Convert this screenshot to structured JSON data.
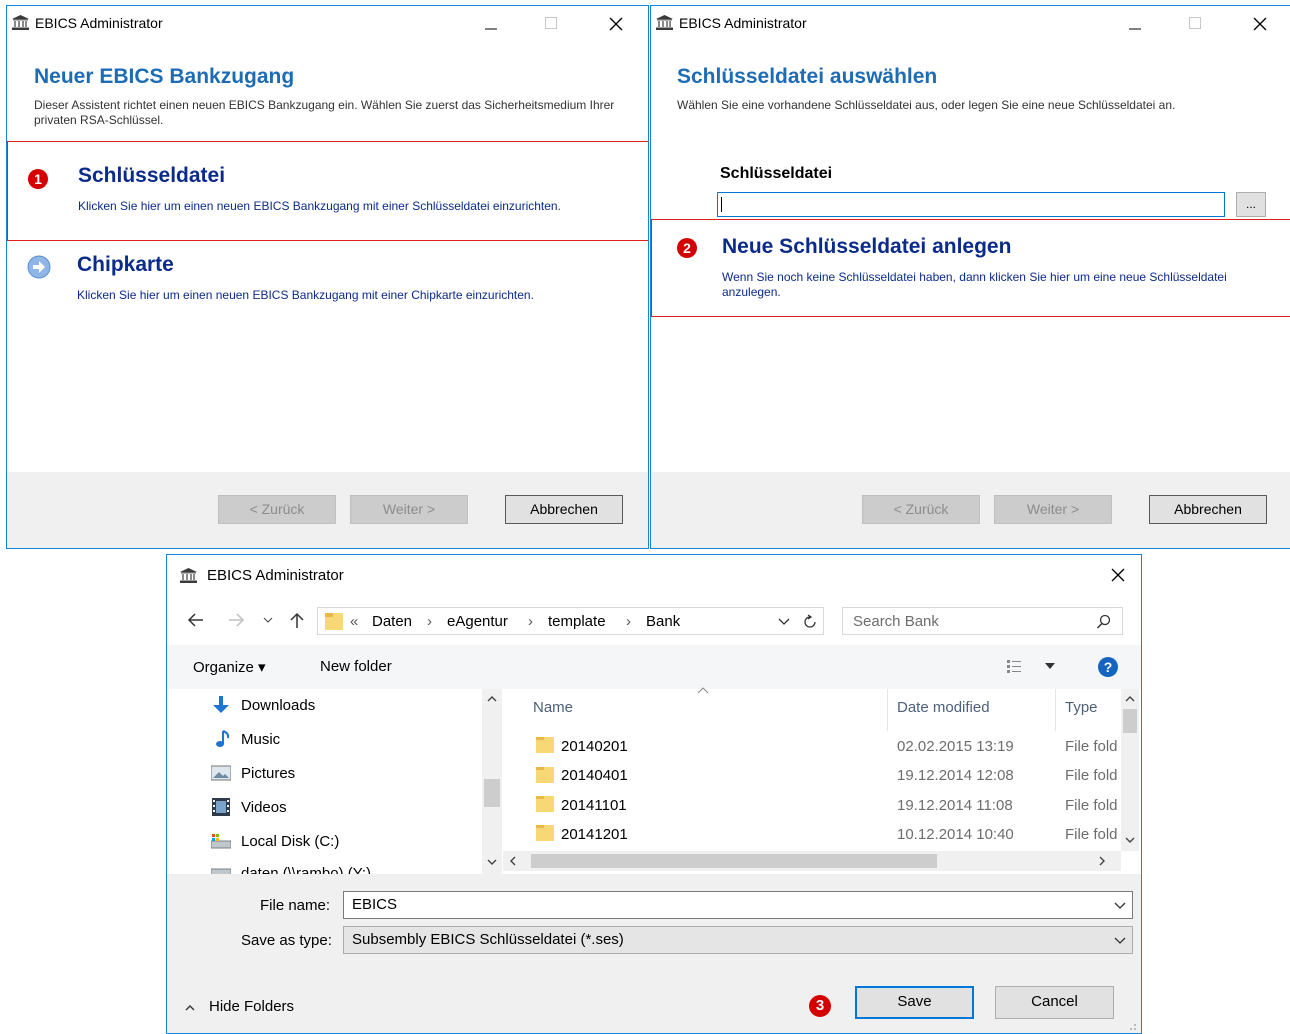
{
  "app_title": "EBICS Administrator",
  "wizard1": {
    "heading": "Neuer EBICS Bankzugang",
    "description": "Dieser Assistent richtet einen neuen EBICS Bankzugang ein. Wählen Sie zuerst das Sicherheitsmedium Ihrer privaten RSA-Schlüssel.",
    "options": [
      {
        "badge": "1",
        "title": "Schlüsseldatei",
        "description": "Klicken Sie hier um einen neuen EBICS Bankzugang mit einer Schlüsseldatei einzurichten.",
        "icon": "number-badge-icon"
      },
      {
        "title": "Chipkarte",
        "description": "Klicken Sie hier um einen neuen EBICS Bankzugang mit einer Chipkarte einzurichten.",
        "icon": "arrow-circle-icon"
      }
    ],
    "buttons": {
      "back": "< Zurück",
      "next": "Weiter >",
      "cancel": "Abbrechen"
    }
  },
  "wizard2": {
    "heading": "Schlüsseldatei auswählen",
    "description": "Wählen Sie eine vorhandene Schlüsseldatei aus, oder legen Sie eine neue Schlüsseldatei an.",
    "field_label": "Schlüsseldatei",
    "field_value": "",
    "browse_label": "...",
    "option": {
      "badge": "2",
      "title": "Neue Schlüsseldatei anlegen",
      "description": "Wenn Sie noch keine Schlüsseldatei haben, dann klicken Sie hier um eine neue Schlüsseldatei anzulegen."
    },
    "buttons": {
      "back": "< Zurück",
      "next": "Weiter >",
      "cancel": "Abbrechen"
    }
  },
  "save_dialog": {
    "title": "EBICS Administrator",
    "breadcrumb": {
      "overflow": "«",
      "items": [
        "Daten",
        "eAgentur",
        "template",
        "Bank"
      ]
    },
    "search_placeholder": "Search Bank",
    "toolbar": {
      "organize": "Organize ▾",
      "new_folder": "New folder"
    },
    "nav_items": [
      {
        "label": "Downloads",
        "icon": "download-arrow-icon"
      },
      {
        "label": "Music",
        "icon": "music-note-icon"
      },
      {
        "label": "Pictures",
        "icon": "pictures-icon"
      },
      {
        "label": "Videos",
        "icon": "videos-icon"
      },
      {
        "label": "Local Disk (C:)",
        "icon": "local-disk-icon"
      },
      {
        "label": "daten (\\\\rambo) (Y:)",
        "icon": "network-drive-icon"
      }
    ],
    "columns": {
      "name": "Name",
      "date": "Date modified",
      "type": "Type"
    },
    "rows": [
      {
        "name": "20140201",
        "date": "02.02.2015 13:19",
        "type": "File folder"
      },
      {
        "name": "20140401",
        "date": "19.12.2014 12:08",
        "type": "File folder"
      },
      {
        "name": "20141101",
        "date": "19.12.2014 11:08",
        "type": "File folder"
      },
      {
        "name": "20141201",
        "date": "10.12.2014 10:40",
        "type": "File folder"
      }
    ],
    "file_name_label": "File name:",
    "file_name_value": "EBICS",
    "save_type_label": "Save as type:",
    "save_type_value": "Subsembly EBICS Schlüsseldatei (*.ses)",
    "hide_folders": "Hide Folders",
    "badge": "3",
    "save": "Save",
    "cancel": "Cancel"
  },
  "colors": {
    "accent": "#1e6cb4",
    "option_text": "#0b2b8a",
    "badge": "#d40000",
    "highlight_border": "#e02020"
  }
}
